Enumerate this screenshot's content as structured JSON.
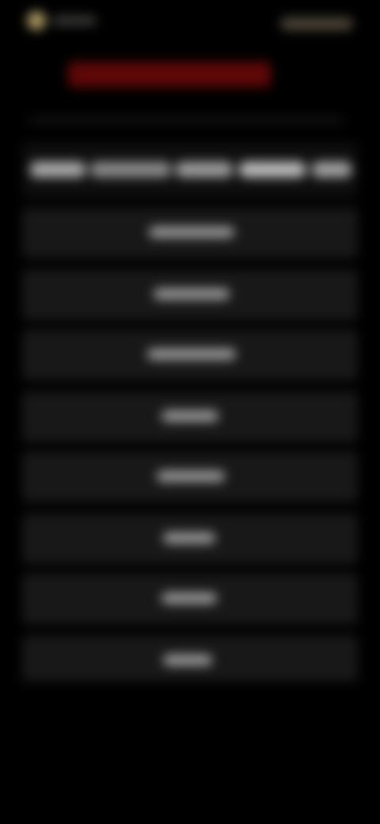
{
  "screen": {
    "title": "",
    "subtitle": "",
    "back_label": "",
    "top_action_label": ""
  },
  "table": {
    "headers": [
      "",
      "",
      "",
      "",
      ""
    ],
    "rows": [
      {
        "cells": [
          "",
          "",
          "",
          "",
          ""
        ]
      },
      {
        "cells": [
          "",
          "",
          "",
          "",
          ""
        ]
      },
      {
        "cells": [
          "",
          "",
          "",
          "",
          ""
        ]
      },
      {
        "cells": [
          "",
          "",
          "",
          "",
          ""
        ]
      },
      {
        "cells": [
          "",
          "",
          "",
          "",
          ""
        ]
      },
      {
        "cells": [
          "",
          "",
          "",
          "",
          ""
        ]
      },
      {
        "cells": [
          "",
          "",
          "",
          "",
          ""
        ]
      },
      {
        "cells": [
          "",
          "",
          "",
          "",
          ""
        ]
      }
    ]
  },
  "colors": {
    "background": "#000000",
    "accent_gold": "#c8b273",
    "title_red": "#5f0707",
    "row_fill": "#181818",
    "text_muted": "#9d9d9d"
  },
  "icons": {
    "top_left": "circle-icon"
  }
}
